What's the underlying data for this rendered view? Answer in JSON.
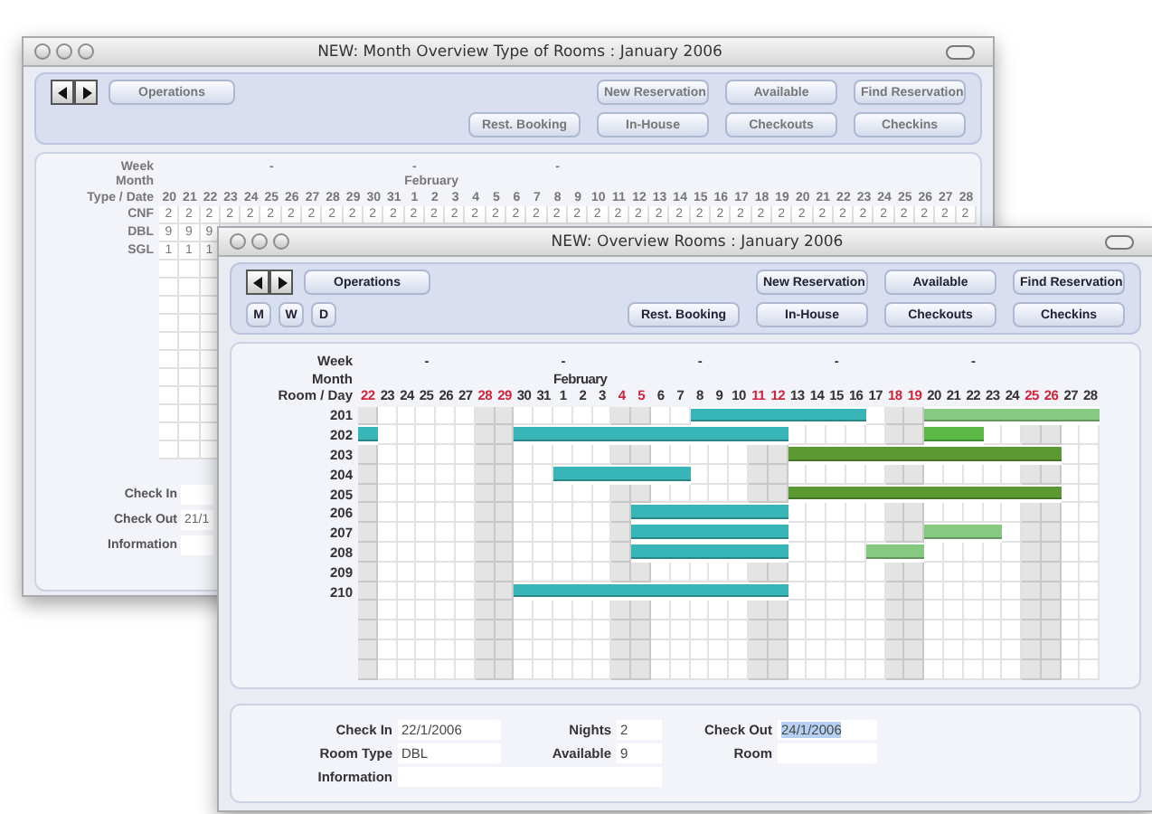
{
  "back_window": {
    "title": "NEW: Month Overview Type of Rooms : January 2006",
    "toolbar": {
      "operations": "Operations",
      "actions_top": [
        "New Reservation",
        "Available",
        "Find Reservation"
      ],
      "actions_bottom": [
        "Rest. Booking",
        "In-House",
        "Checkouts",
        "Checkins"
      ]
    },
    "grid": {
      "header_labels": [
        "Week",
        "Month",
        "Type / Date"
      ],
      "days": [
        {
          "day": "20"
        },
        {
          "day": "21"
        },
        {
          "day": "22"
        },
        {
          "day": "23"
        },
        {
          "day": "24"
        },
        {
          "day": "25",
          "week": "-"
        },
        {
          "day": "26"
        },
        {
          "day": "27"
        },
        {
          "day": "28"
        },
        {
          "day": "29"
        },
        {
          "day": "30"
        },
        {
          "day": "31"
        },
        {
          "day": "1",
          "week": "-",
          "month": "February"
        },
        {
          "day": "2"
        },
        {
          "day": "3"
        },
        {
          "day": "4"
        },
        {
          "day": "5"
        },
        {
          "day": "6"
        },
        {
          "day": "7"
        },
        {
          "day": "8",
          "week": "-"
        },
        {
          "day": "9"
        },
        {
          "day": "10"
        },
        {
          "day": "11"
        },
        {
          "day": "12"
        },
        {
          "day": "13"
        },
        {
          "day": "14"
        },
        {
          "day": "15"
        },
        {
          "day": "16"
        },
        {
          "day": "17"
        },
        {
          "day": "18"
        },
        {
          "day": "19"
        },
        {
          "day": "20"
        },
        {
          "day": "21"
        },
        {
          "day": "22"
        },
        {
          "day": "23"
        },
        {
          "day": "24"
        },
        {
          "day": "25"
        },
        {
          "day": "26"
        },
        {
          "day": "27"
        },
        {
          "day": "28"
        }
      ],
      "rows": [
        {
          "type": "CNF",
          "values": [
            "2",
            "2",
            "2",
            "2",
            "2",
            "2",
            "2",
            "2",
            "2",
            "2",
            "2",
            "2",
            "2",
            "2",
            "2",
            "2",
            "2",
            "2",
            "2",
            "2",
            "2",
            "2",
            "2",
            "2",
            "2",
            "2",
            "2",
            "2",
            "2",
            "2",
            "2",
            "2",
            "2",
            "2",
            "2",
            "2",
            "2",
            "2",
            "2",
            "2"
          ]
        },
        {
          "type": "DBL",
          "values": [
            "9",
            "9",
            "9"
          ]
        },
        {
          "type": "SGL",
          "values": [
            "1",
            "1",
            "1"
          ]
        }
      ]
    },
    "form": [
      {
        "label": "Check In"
      },
      {
        "label": "Check Out",
        "value": "21/1"
      },
      {
        "label": "Information"
      }
    ]
  },
  "front_window": {
    "title": "NEW: Overview Rooms : January 2006",
    "toolbar": {
      "operations": "Operations",
      "modes": [
        "M",
        "W",
        "D"
      ],
      "actions_top": [
        "New Reservation",
        "Available",
        "Find Reservation"
      ],
      "actions_bottom": [
        "Rest. Booking",
        "In-House",
        "Checkouts",
        "Checkins"
      ]
    },
    "grid": {
      "header_labels": [
        "Week",
        "Month",
        "Room / Day"
      ],
      "days": [
        {
          "day": "22",
          "weekend": true
        },
        {
          "day": "23",
          "weekend": false
        },
        {
          "day": "24",
          "weekend": false
        },
        {
          "day": "25",
          "weekend": false,
          "week": "-"
        },
        {
          "day": "26",
          "weekend": false
        },
        {
          "day": "27",
          "weekend": false
        },
        {
          "day": "28",
          "weekend": true
        },
        {
          "day": "29",
          "weekend": true
        },
        {
          "day": "30",
          "weekend": false
        },
        {
          "day": "31",
          "weekend": false
        },
        {
          "day": "1",
          "weekend": false,
          "week": "-",
          "month": "February"
        },
        {
          "day": "2",
          "weekend": false
        },
        {
          "day": "3",
          "weekend": false
        },
        {
          "day": "4",
          "weekend": true
        },
        {
          "day": "5",
          "weekend": true
        },
        {
          "day": "6",
          "weekend": false
        },
        {
          "day": "7",
          "weekend": false
        },
        {
          "day": "8",
          "weekend": false,
          "week": "-"
        },
        {
          "day": "9",
          "weekend": false
        },
        {
          "day": "10",
          "weekend": false
        },
        {
          "day": "11",
          "weekend": true
        },
        {
          "day": "12",
          "weekend": true
        },
        {
          "day": "13",
          "weekend": false
        },
        {
          "day": "14",
          "weekend": false
        },
        {
          "day": "15",
          "weekend": false,
          "week": "-"
        },
        {
          "day": "16",
          "weekend": false
        },
        {
          "day": "17",
          "weekend": false
        },
        {
          "day": "18",
          "weekend": true
        },
        {
          "day": "19",
          "weekend": true
        },
        {
          "day": "20",
          "weekend": false
        },
        {
          "day": "21",
          "weekend": false
        },
        {
          "day": "22",
          "weekend": false,
          "week": "-"
        },
        {
          "day": "23",
          "weekend": false
        },
        {
          "day": "24",
          "weekend": false
        },
        {
          "day": "25",
          "weekend": true
        },
        {
          "day": "26",
          "weekend": true
        },
        {
          "day": "27",
          "weekend": false
        },
        {
          "day": "28",
          "weekend": false
        }
      ],
      "rows": [
        {
          "room": "201",
          "cells": [
            {
              "booked": false
            },
            {
              "booked": false
            },
            {
              "booked": false
            },
            {
              "booked": false
            },
            {
              "booked": false
            },
            {
              "booked": false
            },
            {
              "booked": false
            },
            {
              "booked": false
            },
            {
              "booked": false
            },
            {
              "booked": false
            },
            {
              "booked": false
            },
            {
              "booked": false
            },
            {
              "booked": false
            },
            {
              "booked": false
            },
            {
              "booked": false
            },
            {
              "booked": false
            },
            {
              "booked": false
            },
            {
              "booked": true,
              "color": "#38b5b7"
            },
            {
              "booked": true,
              "color": "#38b5b7"
            },
            {
              "booked": true,
              "color": "#38b5b7"
            },
            {
              "booked": true,
              "color": "#38b5b7"
            },
            {
              "booked": true,
              "color": "#38b5b7"
            },
            {
              "booked": true,
              "color": "#38b5b7"
            },
            {
              "booked": true,
              "color": "#38b5b7"
            },
            {
              "booked": true,
              "color": "#38b5b7"
            },
            {
              "booked": true,
              "color": "#38b5b7"
            },
            {
              "booked": false
            },
            {
              "booked": false
            },
            {
              "booked": false
            },
            {
              "booked": true,
              "color": "#86c980"
            },
            {
              "booked": true,
              "color": "#86c980"
            },
            {
              "booked": true,
              "color": "#86c980"
            },
            {
              "booked": true,
              "color": "#86c980"
            },
            {
              "booked": true,
              "color": "#86c980"
            },
            {
              "booked": true,
              "color": "#86c980"
            },
            {
              "booked": true,
              "color": "#86c980"
            },
            {
              "booked": true,
              "color": "#86c980"
            },
            {
              "booked": true,
              "color": "#86c980"
            }
          ]
        },
        {
          "room": "202",
          "cells": [
            {
              "booked": true,
              "color": "#38b5b7"
            },
            {
              "booked": false
            },
            {
              "booked": false
            },
            {
              "booked": false
            },
            {
              "booked": false
            },
            {
              "booked": false
            },
            {
              "booked": false
            },
            {
              "booked": false
            },
            {
              "booked": true,
              "color": "#38b5b7"
            },
            {
              "booked": true,
              "color": "#38b5b7"
            },
            {
              "booked": true,
              "color": "#38b5b7"
            },
            {
              "booked": true,
              "color": "#38b5b7"
            },
            {
              "booked": true,
              "color": "#38b5b7"
            },
            {
              "booked": true,
              "color": "#38b5b7"
            },
            {
              "booked": true,
              "color": "#38b5b7"
            },
            {
              "booked": true,
              "color": "#38b5b7"
            },
            {
              "booked": true,
              "color": "#38b5b7"
            },
            {
              "booked": true,
              "color": "#38b5b7"
            },
            {
              "booked": true,
              "color": "#38b5b7"
            },
            {
              "booked": true,
              "color": "#38b5b7"
            },
            {
              "booked": true,
              "color": "#38b5b7"
            },
            {
              "booked": true,
              "color": "#38b5b7"
            },
            {
              "booked": false
            },
            {
              "booked": false
            },
            {
              "booked": false
            },
            {
              "booked": false
            },
            {
              "booked": false
            },
            {
              "booked": false
            },
            {
              "booked": false
            },
            {
              "booked": true,
              "color": "#5cb847"
            },
            {
              "booked": true,
              "color": "#5cb847"
            },
            {
              "booked": true,
              "color": "#5cb847"
            },
            {
              "booked": false
            },
            {
              "booked": false
            },
            {
              "booked": false
            },
            {
              "booked": false
            },
            {
              "booked": false
            },
            {
              "booked": false
            }
          ]
        },
        {
          "room": "203",
          "cells": [
            {
              "booked": false
            },
            {
              "booked": false
            },
            {
              "booked": false
            },
            {
              "booked": false
            },
            {
              "booked": false
            },
            {
              "booked": false
            },
            {
              "booked": false
            },
            {
              "booked": false
            },
            {
              "booked": false
            },
            {
              "booked": false
            },
            {
              "booked": false
            },
            {
              "booked": false
            },
            {
              "booked": false
            },
            {
              "booked": false
            },
            {
              "booked": false
            },
            {
              "booked": false
            },
            {
              "booked": false
            },
            {
              "booked": false
            },
            {
              "booked": false
            },
            {
              "booked": false
            },
            {
              "booked": false
            },
            {
              "booked": false
            },
            {
              "booked": true,
              "color": "#5b9a32"
            },
            {
              "booked": true,
              "color": "#5b9a32"
            },
            {
              "booked": true,
              "color": "#5b9a32"
            },
            {
              "booked": true,
              "color": "#5b9a32"
            },
            {
              "booked": true,
              "color": "#5b9a32"
            },
            {
              "booked": true,
              "color": "#5b9a32"
            },
            {
              "booked": true,
              "color": "#5b9a32"
            },
            {
              "booked": true,
              "color": "#5b9a32"
            },
            {
              "booked": true,
              "color": "#5b9a32"
            },
            {
              "booked": true,
              "color": "#5b9a32"
            },
            {
              "booked": true,
              "color": "#5b9a32"
            },
            {
              "booked": true,
              "color": "#5b9a32"
            },
            {
              "booked": true,
              "color": "#5b9a32"
            },
            {
              "booked": true,
              "color": "#5b9a32"
            },
            {
              "booked": false
            },
            {
              "booked": false
            }
          ]
        },
        {
          "room": "204",
          "cells": [
            {
              "booked": false
            },
            {
              "booked": false
            },
            {
              "booked": false
            },
            {
              "booked": false
            },
            {
              "booked": false
            },
            {
              "booked": false
            },
            {
              "booked": false
            },
            {
              "booked": false
            },
            {
              "booked": false
            },
            {
              "booked": false
            },
            {
              "booked": true,
              "color": "#38b5b7"
            },
            {
              "booked": true,
              "color": "#38b5b7"
            },
            {
              "booked": true,
              "color": "#38b5b7"
            },
            {
              "booked": true,
              "color": "#38b5b7"
            },
            {
              "booked": true,
              "color": "#38b5b7"
            },
            {
              "booked": true,
              "color": "#38b5b7"
            },
            {
              "booked": true,
              "color": "#38b5b7"
            },
            {
              "booked": false
            },
            {
              "booked": false
            },
            {
              "booked": false
            },
            {
              "booked": false
            },
            {
              "booked": false
            },
            {
              "booked": false
            },
            {
              "booked": false
            },
            {
              "booked": false
            },
            {
              "booked": false
            },
            {
              "booked": false
            },
            {
              "booked": false
            },
            {
              "booked": false
            },
            {
              "booked": false
            },
            {
              "booked": false
            },
            {
              "booked": false
            },
            {
              "booked": false
            },
            {
              "booked": false
            },
            {
              "booked": false
            },
            {
              "booked": false
            },
            {
              "booked": false
            },
            {
              "booked": false
            }
          ]
        },
        {
          "room": "205",
          "cells": [
            {
              "booked": false
            },
            {
              "booked": false
            },
            {
              "booked": false
            },
            {
              "booked": false
            },
            {
              "booked": false
            },
            {
              "booked": false
            },
            {
              "booked": false
            },
            {
              "booked": false
            },
            {
              "booked": false
            },
            {
              "booked": false
            },
            {
              "booked": false
            },
            {
              "booked": false
            },
            {
              "booked": false
            },
            {
              "booked": false
            },
            {
              "booked": false
            },
            {
              "booked": false
            },
            {
              "booked": false
            },
            {
              "booked": false
            },
            {
              "booked": false
            },
            {
              "booked": false
            },
            {
              "booked": false
            },
            {
              "booked": false
            },
            {
              "booked": true,
              "color": "#5b9a32"
            },
            {
              "booked": true,
              "color": "#5b9a32"
            },
            {
              "booked": true,
              "color": "#5b9a32"
            },
            {
              "booked": true,
              "color": "#5b9a32"
            },
            {
              "booked": true,
              "color": "#5b9a32"
            },
            {
              "booked": true,
              "color": "#5b9a32"
            },
            {
              "booked": true,
              "color": "#5b9a32"
            },
            {
              "booked": true,
              "color": "#5b9a32"
            },
            {
              "booked": true,
              "color": "#5b9a32"
            },
            {
              "booked": true,
              "color": "#5b9a32"
            },
            {
              "booked": true,
              "color": "#5b9a32"
            },
            {
              "booked": true,
              "color": "#5b9a32"
            },
            {
              "booked": true,
              "color": "#5b9a32"
            },
            {
              "booked": true,
              "color": "#5b9a32"
            },
            {
              "booked": false
            },
            {
              "booked": false
            }
          ]
        },
        {
          "room": "206",
          "cells": [
            {
              "booked": false
            },
            {
              "booked": false
            },
            {
              "booked": false
            },
            {
              "booked": false
            },
            {
              "booked": false
            },
            {
              "booked": false
            },
            {
              "booked": false
            },
            {
              "booked": false
            },
            {
              "booked": false
            },
            {
              "booked": false
            },
            {
              "booked": false
            },
            {
              "booked": false
            },
            {
              "booked": false
            },
            {
              "booked": false
            },
            {
              "booked": true,
              "color": "#38b5b7"
            },
            {
              "booked": true,
              "color": "#38b5b7"
            },
            {
              "booked": true,
              "color": "#38b5b7"
            },
            {
              "booked": true,
              "color": "#38b5b7"
            },
            {
              "booked": true,
              "color": "#38b5b7"
            },
            {
              "booked": true,
              "color": "#38b5b7"
            },
            {
              "booked": true,
              "color": "#38b5b7"
            },
            {
              "booked": true,
              "color": "#38b5b7"
            },
            {
              "booked": false
            },
            {
              "booked": false
            },
            {
              "booked": false
            },
            {
              "booked": false
            },
            {
              "booked": false
            },
            {
              "booked": false
            },
            {
              "booked": false
            },
            {
              "booked": false
            },
            {
              "booked": false
            },
            {
              "booked": false
            },
            {
              "booked": false
            },
            {
              "booked": false
            },
            {
              "booked": false
            },
            {
              "booked": false
            },
            {
              "booked": false
            },
            {
              "booked": false
            }
          ]
        },
        {
          "room": "207",
          "cells": [
            {
              "booked": false
            },
            {
              "booked": false
            },
            {
              "booked": false
            },
            {
              "booked": false
            },
            {
              "booked": false
            },
            {
              "booked": false
            },
            {
              "booked": false
            },
            {
              "booked": false
            },
            {
              "booked": false
            },
            {
              "booked": false
            },
            {
              "booked": false
            },
            {
              "booked": false
            },
            {
              "booked": false
            },
            {
              "booked": false
            },
            {
              "booked": true,
              "color": "#38b5b7"
            },
            {
              "booked": true,
              "color": "#38b5b7"
            },
            {
              "booked": true,
              "color": "#38b5b7"
            },
            {
              "booked": true,
              "color": "#38b5b7"
            },
            {
              "booked": true,
              "color": "#38b5b7"
            },
            {
              "booked": true,
              "color": "#38b5b7"
            },
            {
              "booked": true,
              "color": "#38b5b7"
            },
            {
              "booked": true,
              "color": "#38b5b7"
            },
            {
              "booked": false
            },
            {
              "booked": false
            },
            {
              "booked": false
            },
            {
              "booked": false
            },
            {
              "booked": false
            },
            {
              "booked": false
            },
            {
              "booked": false
            },
            {
              "booked": true,
              "color": "#86c980"
            },
            {
              "booked": true,
              "color": "#86c980"
            },
            {
              "booked": true,
              "color": "#86c980"
            },
            {
              "booked": true,
              "color": "#86c980"
            },
            {
              "booked": false
            },
            {
              "booked": false
            },
            {
              "booked": false
            },
            {
              "booked": false
            },
            {
              "booked": false
            }
          ]
        },
        {
          "room": "208",
          "cells": [
            {
              "booked": false
            },
            {
              "booked": false
            },
            {
              "booked": false
            },
            {
              "booked": false
            },
            {
              "booked": false
            },
            {
              "booked": false
            },
            {
              "booked": false
            },
            {
              "booked": false
            },
            {
              "booked": false
            },
            {
              "booked": false
            },
            {
              "booked": false
            },
            {
              "booked": false
            },
            {
              "booked": false
            },
            {
              "booked": false
            },
            {
              "booked": true,
              "color": "#38b5b7"
            },
            {
              "booked": true,
              "color": "#38b5b7"
            },
            {
              "booked": true,
              "color": "#38b5b7"
            },
            {
              "booked": true,
              "color": "#38b5b7"
            },
            {
              "booked": true,
              "color": "#38b5b7"
            },
            {
              "booked": true,
              "color": "#38b5b7"
            },
            {
              "booked": true,
              "color": "#38b5b7"
            },
            {
              "booked": true,
              "color": "#38b5b7"
            },
            {
              "booked": false
            },
            {
              "booked": false
            },
            {
              "booked": false
            },
            {
              "booked": false
            },
            {
              "booked": true,
              "color": "#86c980"
            },
            {
              "booked": true,
              "color": "#86c980"
            },
            {
              "booked": true,
              "color": "#86c980"
            },
            {
              "booked": false
            },
            {
              "booked": false
            },
            {
              "booked": false
            },
            {
              "booked": false
            },
            {
              "booked": false
            },
            {
              "booked": false
            },
            {
              "booked": false
            },
            {
              "booked": false
            },
            {
              "booked": false
            }
          ]
        },
        {
          "room": "209",
          "cells": [
            {
              "booked": false
            },
            {
              "booked": false
            },
            {
              "booked": false
            },
            {
              "booked": false
            },
            {
              "booked": false
            },
            {
              "booked": false
            },
            {
              "booked": false
            },
            {
              "booked": false
            },
            {
              "booked": false
            },
            {
              "booked": false
            },
            {
              "booked": false
            },
            {
              "booked": false
            },
            {
              "booked": false
            },
            {
              "booked": false
            },
            {
              "booked": false
            },
            {
              "booked": false
            },
            {
              "booked": false
            },
            {
              "booked": false
            },
            {
              "booked": false
            },
            {
              "booked": false
            },
            {
              "booked": false
            },
            {
              "booked": false
            },
            {
              "booked": false
            },
            {
              "booked": false
            },
            {
              "booked": false
            },
            {
              "booked": false
            },
            {
              "booked": false
            },
            {
              "booked": false
            },
            {
              "booked": false
            },
            {
              "booked": false
            },
            {
              "booked": false
            },
            {
              "booked": false
            },
            {
              "booked": false
            },
            {
              "booked": false
            },
            {
              "booked": false
            },
            {
              "booked": false
            },
            {
              "booked": false
            },
            {
              "booked": false
            }
          ]
        },
        {
          "room": "210",
          "cells": [
            {
              "booked": false
            },
            {
              "booked": false
            },
            {
              "booked": false
            },
            {
              "booked": false
            },
            {
              "booked": false
            },
            {
              "booked": false
            },
            {
              "booked": false
            },
            {
              "booked": false
            },
            {
              "booked": true,
              "color": "#38b5b7"
            },
            {
              "booked": true,
              "color": "#38b5b7"
            },
            {
              "booked": true,
              "color": "#38b5b7"
            },
            {
              "booked": true,
              "color": "#38b5b7"
            },
            {
              "booked": true,
              "color": "#38b5b7"
            },
            {
              "booked": true,
              "color": "#38b5b7"
            },
            {
              "booked": true,
              "color": "#38b5b7"
            },
            {
              "booked": true,
              "color": "#38b5b7"
            },
            {
              "booked": true,
              "color": "#38b5b7"
            },
            {
              "booked": true,
              "color": "#38b5b7"
            },
            {
              "booked": true,
              "color": "#38b5b7"
            },
            {
              "booked": true,
              "color": "#38b5b7"
            },
            {
              "booked": true,
              "color": "#38b5b7"
            },
            {
              "booked": true,
              "color": "#38b5b7"
            },
            {
              "booked": false
            },
            {
              "booked": false
            },
            {
              "booked": false
            },
            {
              "booked": false
            },
            {
              "booked": false
            },
            {
              "booked": false
            },
            {
              "booked": false
            },
            {
              "booked": false
            },
            {
              "booked": false
            },
            {
              "booked": false
            },
            {
              "booked": false
            },
            {
              "booked": false
            },
            {
              "booked": false
            },
            {
              "booked": false
            },
            {
              "booked": false
            },
            {
              "booked": false
            }
          ]
        }
      ]
    },
    "form": [
      {
        "label": "Check In",
        "value": "22/1/2006",
        "kind": "short",
        "highlighted": false
      },
      {
        "label": "Nights",
        "value": "2",
        "kind": "short",
        "highlighted": false
      },
      {
        "label": "Check Out",
        "value": "24/1/2006",
        "kind": "short",
        "highlighted": true
      },
      {
        "label": "Room Type",
        "value": "DBL",
        "kind": "short",
        "highlighted": false
      },
      {
        "label": "Available",
        "value": "9",
        "kind": "short",
        "highlighted": false
      },
      {
        "label": "Room",
        "kind": "short"
      },
      {
        "label": "Information",
        "kind": "wide"
      }
    ]
  }
}
